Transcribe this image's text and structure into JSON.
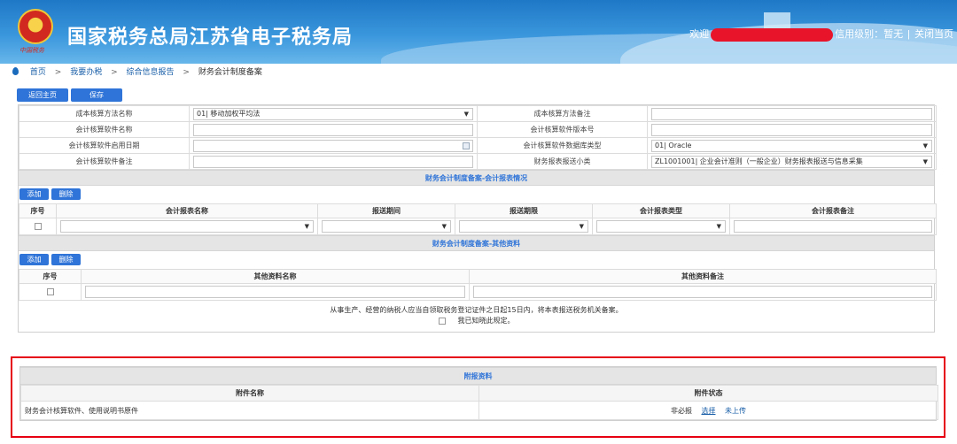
{
  "header": {
    "site_title": "国家税务总局江苏省电子税务局",
    "slogan": "中国税务",
    "welcome": "欢迎",
    "credit_level": "信用级别：暂无",
    "separator": "|",
    "close_page": "关闭当页"
  },
  "breadcrumb": {
    "items": [
      "首页",
      "我要办税",
      "综合信息报告"
    ],
    "arrow": ">",
    "current": "财务会计制度备案"
  },
  "toolbar": {
    "back_home": "返回主页",
    "save": "保存"
  },
  "form": {
    "rows": [
      {
        "label_left": "成本核算方法名称",
        "value_left": "01| 移动加权平均法",
        "label_right": "成本核算方法备注",
        "value_right": ""
      },
      {
        "label_left": "会计核算软件名称",
        "value_left": "",
        "label_right": "会计核算软件版本号",
        "value_right": ""
      },
      {
        "label_left": "会计核算软件启用日期",
        "value_left": "",
        "label_right": "会计核算软件数据库类型",
        "value_right": "01| Oracle"
      },
      {
        "label_left": "会计核算软件备注",
        "value_left": "",
        "label_right": "财务报表报送小类",
        "value_right": "ZL1001001| 企业会计准则（一般企业）财务报表报送与信息采集"
      }
    ]
  },
  "report_section": {
    "title": "财务会计制度备案-会计报表情况",
    "add": "添加",
    "delete": "删除",
    "columns": [
      "序号",
      "会计报表名称",
      "报送期间",
      "报送期限",
      "会计报表类型",
      "会计报表备注"
    ]
  },
  "other_section": {
    "title": "财务会计制度备案-其他资料",
    "add": "添加",
    "delete": "删除",
    "columns": [
      "序号",
      "其他资料名称",
      "其他资料备注"
    ]
  },
  "notice": "从事生产、经营的纳税人应当自领取税务登记证件之日起15日内，将本表报送税务机关备案。",
  "confirm_label": "我已知晓此规定。",
  "attachments": {
    "title": "附报资料",
    "columns": [
      "附件名称",
      "附件状态"
    ],
    "rows": [
      {
        "name": "财务会计核算软件、使用说明书原件",
        "required": "非必报",
        "action": "选择",
        "status": "未上传"
      }
    ]
  },
  "colors": {
    "accent": "#2f74d8",
    "highlight_border": "#e60012",
    "header_blue": "#1f78c6"
  },
  "icons": [
    "location-pin-icon",
    "calendar-icon",
    "dropdown-caret-icon",
    "checkbox-icon",
    "tax-emblem-icon"
  ]
}
